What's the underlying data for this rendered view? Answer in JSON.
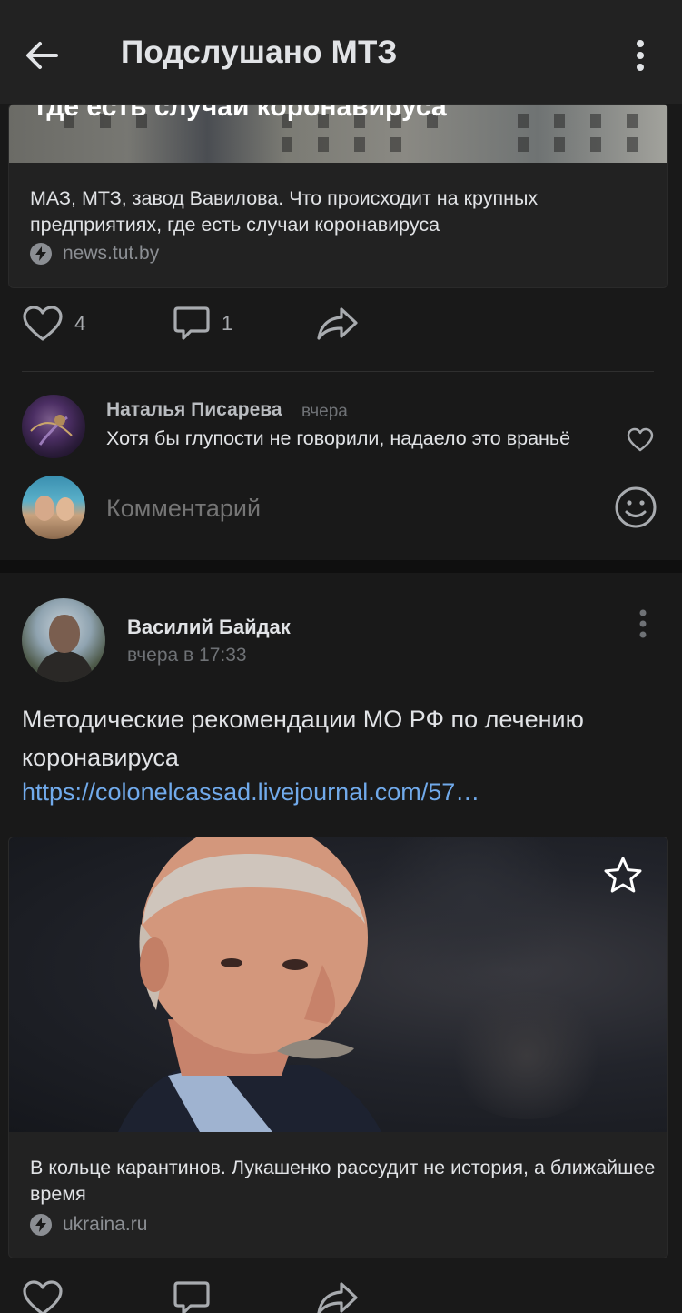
{
  "header": {
    "title": "Подслушано МТЗ"
  },
  "post1": {
    "card": {
      "image_overlay_title": "где есть случаи коронавируса",
      "title": "МАЗ, МТЗ, завод Вавилова. Что происходит на крупных предприятиях, где есть случаи коронавируса",
      "source": "news.tut.by"
    },
    "actions": {
      "likes": "4",
      "comments": "1"
    },
    "comment": {
      "author": "Наталья Писарева",
      "time": "вчера",
      "text": "Хотя бы глупости не говорили, надаело это враньё"
    },
    "composer": {
      "placeholder": "Комментарий"
    }
  },
  "post2": {
    "author": "Василий Байдак",
    "time": "вчера в 17:33",
    "text": "Методические рекомендации МО РФ по лечению коронавируса",
    "link": "https://colonelcassad.livejournal.com/57…",
    "card": {
      "title": "В кольце карантинов. Лукашенко рассудит не история, а ближайшее время",
      "source": "ukraina.ru"
    }
  },
  "colors": {
    "background": "#191919",
    "header": "#222222",
    "text": "#e1e3e6",
    "secondary": "#8b8e93",
    "link": "#71aaeb"
  }
}
